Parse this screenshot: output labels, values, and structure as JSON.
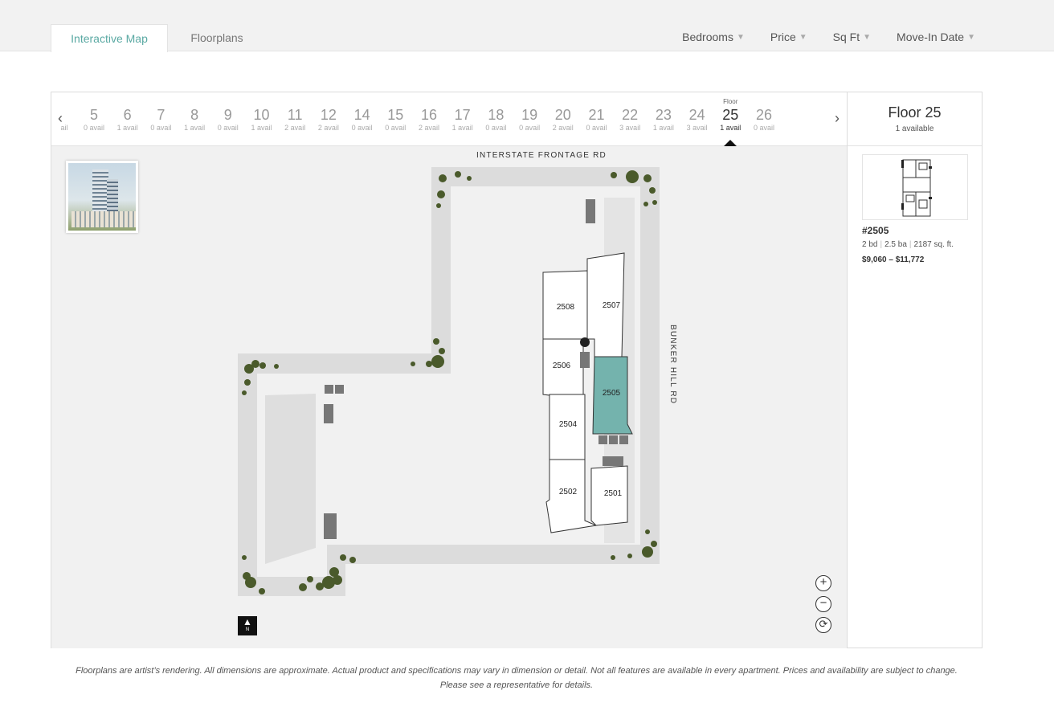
{
  "tabs": [
    {
      "label": "Interactive Map",
      "active": true
    },
    {
      "label": "Floorplans",
      "active": false
    }
  ],
  "filters": [
    "Bedrooms",
    "Price",
    "Sq Ft",
    "Move-In Date"
  ],
  "floor_nav": {
    "partial_label": "ail",
    "floor_caption": "Floor",
    "floors": [
      {
        "num": "5",
        "avail": "0 avail"
      },
      {
        "num": "6",
        "avail": "1 avail"
      },
      {
        "num": "7",
        "avail": "0 avail"
      },
      {
        "num": "8",
        "avail": "1 avail"
      },
      {
        "num": "9",
        "avail": "0 avail"
      },
      {
        "num": "10",
        "avail": "1 avail"
      },
      {
        "num": "11",
        "avail": "2 avail"
      },
      {
        "num": "12",
        "avail": "2 avail"
      },
      {
        "num": "14",
        "avail": "0 avail"
      },
      {
        "num": "15",
        "avail": "0 avail"
      },
      {
        "num": "16",
        "avail": "2 avail"
      },
      {
        "num": "17",
        "avail": "1 avail"
      },
      {
        "num": "18",
        "avail": "0 avail"
      },
      {
        "num": "19",
        "avail": "0 avail"
      },
      {
        "num": "20",
        "avail": "2 avail"
      },
      {
        "num": "21",
        "avail": "0 avail"
      },
      {
        "num": "22",
        "avail": "3 avail"
      },
      {
        "num": "23",
        "avail": "1 avail"
      },
      {
        "num": "24",
        "avail": "3 avail"
      },
      {
        "num": "25",
        "avail": "1 avail",
        "selected": true
      },
      {
        "num": "26",
        "avail": "0 avail"
      }
    ]
  },
  "map": {
    "streets": {
      "top": "INTERSTATE FRONTAGE RD",
      "right": "BUNKER HILL RD"
    },
    "units": [
      "2508",
      "2507",
      "2506",
      "2505",
      "2504",
      "2502",
      "2501"
    ],
    "highlight_unit": "2505",
    "highlight_color": "#74b3ad",
    "north_label": "N",
    "zoom_controls": [
      "+",
      "−",
      "⟳"
    ]
  },
  "side": {
    "title": "Floor 25",
    "subtitle": "1 available",
    "unit": "#2505",
    "beds": "2 bd",
    "baths": "2.5 ba",
    "sqft": "2187 sq. ft.",
    "price": "$9,060 – $11,772"
  },
  "disclaimer": "Floorplans are artist’s rendering. All dimensions are approximate. Actual product and specifications may vary in dimension or detail. Not all features are available in every apartment. Prices and availability are subject to change. Please see a representative for details.",
  "colors": {
    "accent": "#5aa9a3",
    "highlight": "#74b3ad",
    "tree": "#4a5a2b"
  }
}
